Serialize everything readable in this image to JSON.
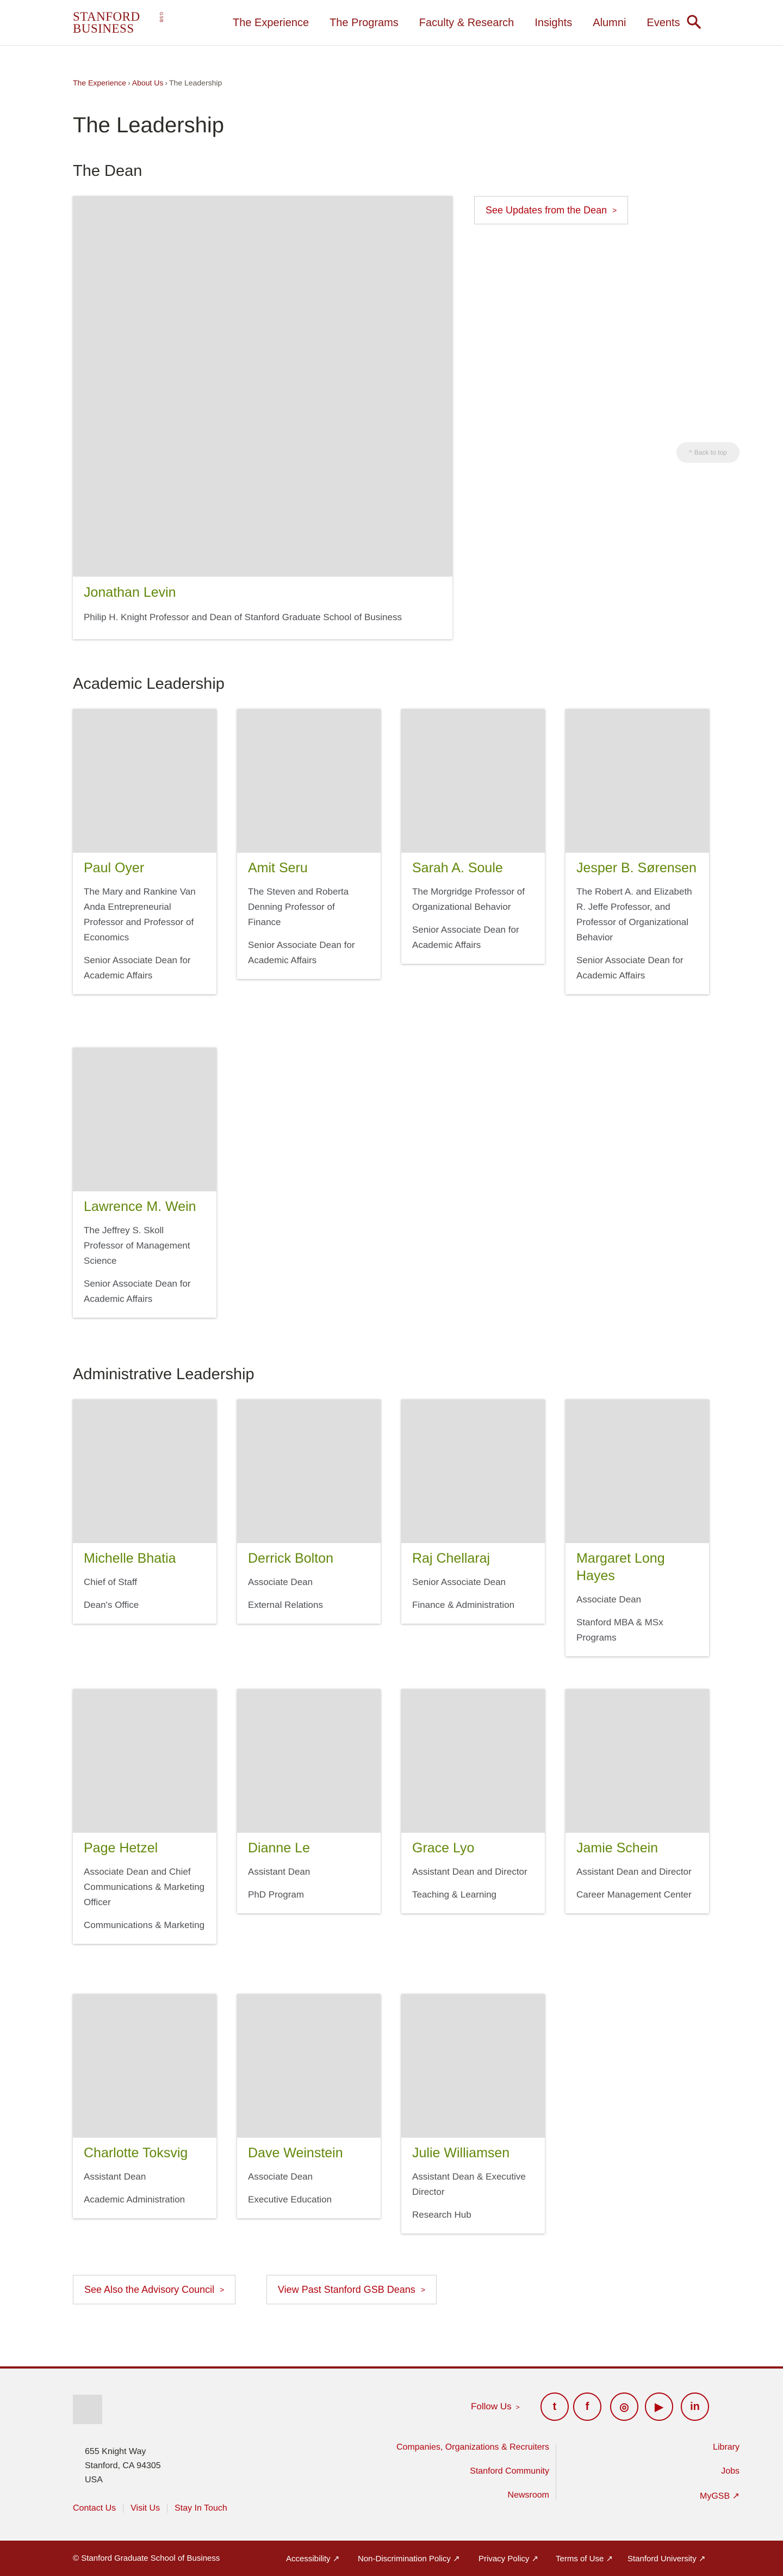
{
  "header": {
    "logo_line1": "STANFORD",
    "logo_line2": "BUSINESS",
    "logo_side": "GSB",
    "nav": [
      "The Experience",
      "The Programs",
      "Faculty & Research",
      "Insights",
      "Alumni",
      "Events"
    ],
    "search_icon": "search-icon"
  },
  "breadcrumb": {
    "items": [
      "The Experience",
      "About Us",
      "The Leadership"
    ],
    "separator": "›"
  },
  "page_title": "The Leadership",
  "dean_section": {
    "heading": "The Dean",
    "name": "Jonathan Levin",
    "title": "Philip H. Knight Professor and Dean of Stanford Graduate School of Business",
    "updates_button": "See Updates from the Dean",
    "back_to_top": "Back to top"
  },
  "academic": {
    "heading": "Academic Leadership",
    "people": [
      {
        "name": "Paul Oyer",
        "lines": [
          "The Mary and Rankine Van Anda Entrepreneurial Professor and Professor of Economics",
          "Senior Associate Dean for Academic Affairs"
        ]
      },
      {
        "name": "Amit Seru",
        "lines": [
          "The Steven and Roberta Denning Professor of Finance",
          "Senior Associate Dean for Academic Affairs"
        ]
      },
      {
        "name": "Sarah A. Soule",
        "lines": [
          "The Morgridge Professor of Organizational Behavior",
          "Senior Associate Dean for Academic Affairs"
        ]
      },
      {
        "name": "Jesper B. Sørensen",
        "lines": [
          "The Robert A. and Elizabeth R. Jeffe Professor, and Professor of Organizational Behavior",
          "Senior Associate Dean for Academic Affairs"
        ]
      },
      {
        "name": "Lawrence M. Wein",
        "lines": [
          "The Jeffrey S. Skoll Professor of Management Science",
          "Senior Associate Dean for Academic Affairs"
        ]
      }
    ]
  },
  "administrative": {
    "heading": "Administrative Leadership",
    "people": [
      {
        "name": "Michelle Bhatia",
        "lines": [
          "Chief of Staff",
          "Dean's Office"
        ]
      },
      {
        "name": "Derrick Bolton",
        "lines": [
          "Associate Dean",
          "External Relations"
        ]
      },
      {
        "name": "Raj Chellaraj",
        "lines": [
          "Senior Associate Dean",
          "Finance & Administration"
        ]
      },
      {
        "name": "Margaret Long Hayes",
        "lines": [
          "Associate Dean",
          "Stanford MBA & MSx Programs"
        ]
      },
      {
        "name": "Page Hetzel",
        "lines": [
          "Associate Dean and Chief Communications & Marketing Officer",
          "Communications & Marketing"
        ]
      },
      {
        "name": "Dianne Le",
        "lines": [
          "Assistant Dean",
          "PhD Program"
        ]
      },
      {
        "name": "Grace Lyo",
        "lines": [
          "Assistant Dean and Director",
          "Teaching & Learning"
        ]
      },
      {
        "name": "Jamie Schein",
        "lines": [
          "Assistant Dean and Director",
          "Career Management Center"
        ]
      },
      {
        "name": "Charlotte Toksvig",
        "lines": [
          "Assistant Dean",
          "Academic Administration"
        ]
      },
      {
        "name": "Dave Weinstein",
        "lines": [
          "Associate Dean",
          "Executive Education"
        ]
      },
      {
        "name": "Julie Williamsen",
        "lines": [
          "Assistant Dean & Executive Director",
          "Research Hub"
        ]
      }
    ]
  },
  "bottom_buttons": {
    "advisory": "See Also the Advisory Council",
    "past_deans": "View Past Stanford GSB Deans"
  },
  "footer": {
    "follow_us": "Follow Us",
    "social": [
      {
        "icon": "twitter-icon",
        "glyph": "t"
      },
      {
        "icon": "facebook-icon",
        "glyph": "f"
      },
      {
        "icon": "instagram-icon",
        "glyph": "◎"
      },
      {
        "icon": "youtube-icon",
        "glyph": "▶"
      },
      {
        "icon": "linkedin-icon",
        "glyph": "in"
      }
    ],
    "address": [
      "655 Knight Way",
      "Stanford, CA 94305",
      "USA"
    ],
    "utility_links": [
      "Contact Us",
      "Visit Us",
      "Stay In Touch"
    ],
    "middle_links": [
      "Companies, Organizations & Recruiters",
      "Stanford Community",
      "Newsroom"
    ],
    "right_links": [
      "Library",
      "Jobs",
      "MyGSB ↗"
    ]
  },
  "bottom_bar": {
    "copyright": "© Stanford Graduate School of Business",
    "links": [
      "Accessibility ↗",
      "Non-Discrimination Policy ↗",
      "Privacy Policy ↗",
      "Terms of Use ↗",
      "Stanford University ↗"
    ]
  },
  "colors": {
    "brand_red": "#8c1515",
    "link_red": "#b1040e",
    "name_green": "#62880b",
    "photo_placeholder": "#dedede"
  }
}
